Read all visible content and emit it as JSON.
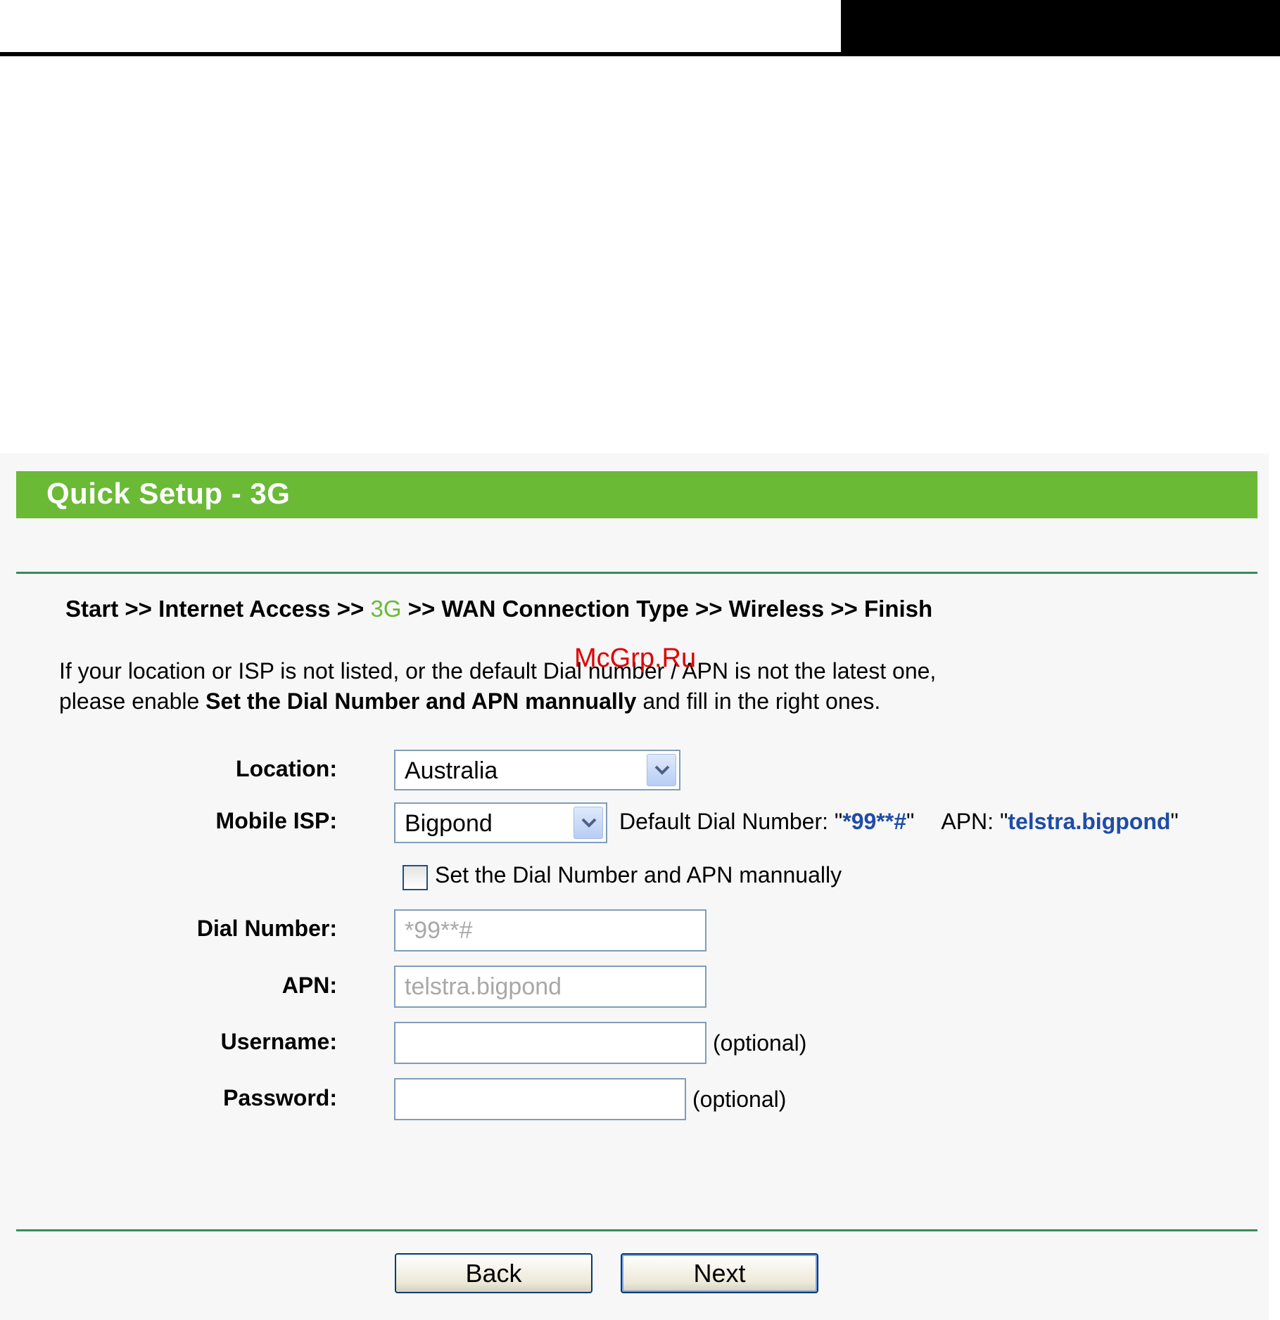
{
  "page": {
    "title": "Quick Setup - 3G",
    "watermark": "McGrp.Ru"
  },
  "breadcrumb": {
    "prefix": "Start >> Internet Access >> ",
    "current": "3G",
    "suffix": " >> WAN Connection Type >> Wireless >> Finish"
  },
  "help": {
    "line1": "If your location or ISP is not listed, or the default Dial number / APN is not the latest one,",
    "line2_pre": "please enable ",
    "line2_bold": "Set the Dial Number and APN mannually",
    "line2_post": " and fill in the right ones."
  },
  "form": {
    "location": {
      "label": "Location:",
      "value": "Australia"
    },
    "mobile_isp": {
      "label": "Mobile ISP:",
      "value": "Bigpond"
    },
    "defaults": {
      "dial_prefix": "Default Dial Number: \"",
      "dial_value": "*99**#",
      "dial_suffix": "\"",
      "apn_prefix": "APN: \"",
      "apn_value": "telstra.bigpond",
      "apn_suffix": "\""
    },
    "manual_checkbox": {
      "label": "Set the Dial Number and APN mannually",
      "checked": false
    },
    "dial_number": {
      "label": "Dial Number:",
      "value": "*99**#"
    },
    "apn": {
      "label": "APN:",
      "value": "telstra.bigpond"
    },
    "username": {
      "label": "Username:",
      "value": "",
      "note": "(optional)"
    },
    "password": {
      "label": "Password:",
      "value": "",
      "note": "(optional)"
    }
  },
  "buttons": {
    "back": "Back",
    "next": "Next"
  },
  "colors": {
    "banner": "#6aba35",
    "link_blue": "#1e4ca8",
    "rule": "#3a8a5a"
  }
}
